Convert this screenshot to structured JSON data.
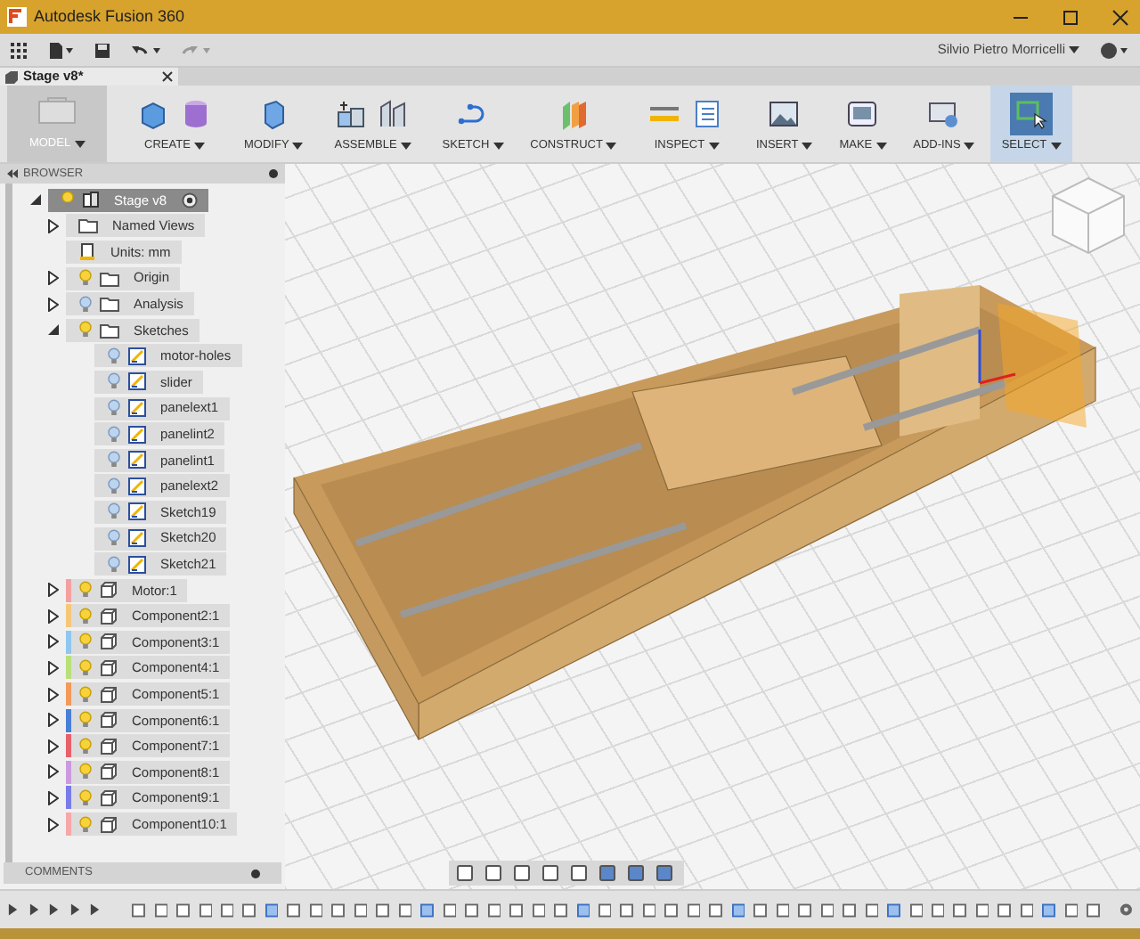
{
  "window": {
    "title": "Autodesk Fusion 360"
  },
  "quick_access": {
    "user": "Silvio Pietro Morricelli"
  },
  "document_tab": {
    "title": "Stage v8*"
  },
  "ribbon": {
    "workspace": "MODEL",
    "groups": [
      {
        "label": "CREATE",
        "kind": "create",
        "selected": false
      },
      {
        "label": "MODIFY",
        "kind": "modify",
        "selected": false
      },
      {
        "label": "ASSEMBLE",
        "kind": "assemble",
        "selected": false
      },
      {
        "label": "SKETCH",
        "kind": "sketch",
        "selected": false
      },
      {
        "label": "CONSTRUCT",
        "kind": "construct",
        "selected": false
      },
      {
        "label": "INSPECT",
        "kind": "inspect",
        "selected": false
      },
      {
        "label": "INSERT",
        "kind": "insert",
        "selected": false
      },
      {
        "label": "MAKE",
        "kind": "make",
        "selected": false
      },
      {
        "label": "ADD-INS",
        "kind": "addins",
        "selected": false
      },
      {
        "label": "SELECT",
        "kind": "select",
        "selected": true
      }
    ]
  },
  "browser": {
    "title": "BROWSER",
    "tree": [
      {
        "label": "Stage v8",
        "kind": "root",
        "selected": true,
        "expanded": true,
        "children": [
          {
            "label": "Named Views",
            "kind": "folder",
            "selected": false,
            "expanded": false
          },
          {
            "label": "Units: mm",
            "kind": "units",
            "selected": false
          },
          {
            "label": "Origin",
            "kind": "folder",
            "selected": false,
            "expanded": false,
            "visible": true
          },
          {
            "label": "Analysis",
            "kind": "folder",
            "selected": false,
            "expanded": false,
            "visible": false
          },
          {
            "label": "Sketches",
            "kind": "folder",
            "selected": false,
            "expanded": true,
            "visible": true,
            "children": [
              {
                "label": "motor-holes",
                "kind": "sketch",
                "selected": false,
                "visible": false
              },
              {
                "label": "slider",
                "kind": "sketch",
                "selected": false,
                "visible": false
              },
              {
                "label": "panelext1",
                "kind": "sketch",
                "selected": false,
                "visible": false
              },
              {
                "label": "panelint2",
                "kind": "sketch",
                "selected": false,
                "visible": false
              },
              {
                "label": "panelint1",
                "kind": "sketch",
                "selected": false,
                "visible": false
              },
              {
                "label": "panelext2",
                "kind": "sketch",
                "selected": false,
                "visible": false
              },
              {
                "label": "Sketch19",
                "kind": "sketch",
                "selected": false,
                "visible": false
              },
              {
                "label": "Sketch20",
                "kind": "sketch",
                "selected": false,
                "visible": false
              },
              {
                "label": "Sketch21",
                "kind": "sketch",
                "selected": false,
                "visible": false
              }
            ]
          },
          {
            "label": "Motor:1",
            "kind": "component",
            "selected": false,
            "expanded": false,
            "visible": true,
            "color": "#f4a0a0"
          },
          {
            "label": "Component2:1",
            "kind": "component",
            "selected": false,
            "expanded": false,
            "visible": true,
            "color": "#f5c77a"
          },
          {
            "label": "Component3:1",
            "kind": "component",
            "selected": false,
            "expanded": false,
            "visible": true,
            "color": "#8fc7ee"
          },
          {
            "label": "Component4:1",
            "kind": "component",
            "selected": false,
            "expanded": false,
            "visible": true,
            "color": "#b8e07a"
          },
          {
            "label": "Component5:1",
            "kind": "component",
            "selected": false,
            "expanded": false,
            "visible": true,
            "color": "#f39a5a"
          },
          {
            "label": "Component6:1",
            "kind": "component",
            "selected": false,
            "expanded": false,
            "visible": true,
            "color": "#4a7fd6"
          },
          {
            "label": "Component7:1",
            "kind": "component",
            "selected": false,
            "expanded": false,
            "visible": true,
            "color": "#e8606a"
          },
          {
            "label": "Component8:1",
            "kind": "component",
            "selected": false,
            "expanded": false,
            "visible": true,
            "color": "#cc99e0"
          },
          {
            "label": "Component9:1",
            "kind": "component",
            "selected": false,
            "expanded": false,
            "visible": true,
            "color": "#7a7ae8"
          },
          {
            "label": "Component10:1",
            "kind": "component",
            "selected": false,
            "expanded": false,
            "visible": true,
            "color": "#f6a8a8"
          }
        ]
      }
    ]
  },
  "comments": {
    "title": "COMMENTS"
  }
}
